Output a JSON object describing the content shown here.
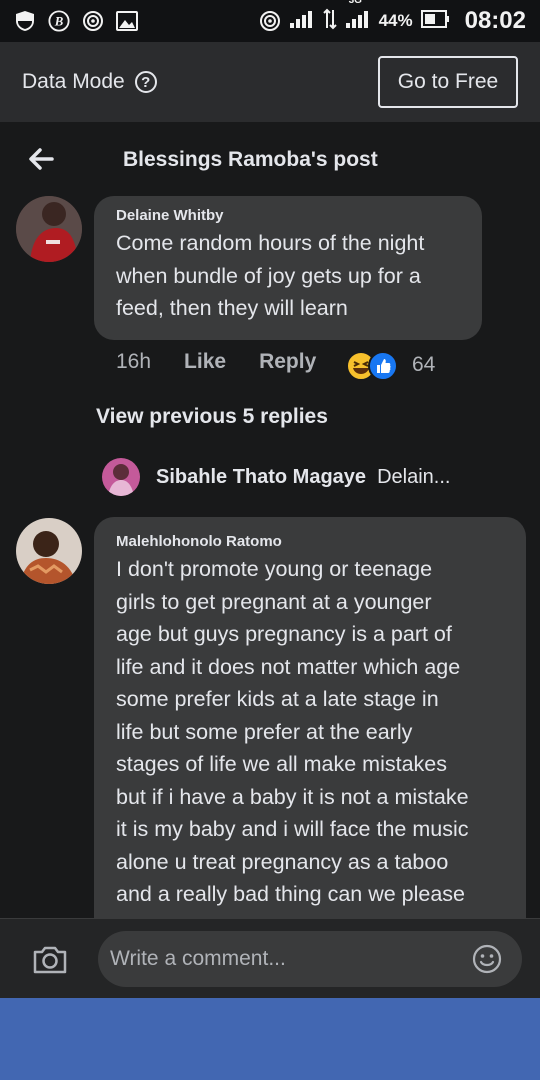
{
  "status_bar": {
    "battery": "44%",
    "time": "08:02",
    "network": "3G"
  },
  "data_mode": {
    "label": "Data Mode",
    "help_icon": "?",
    "go_free_label": "Go to Free"
  },
  "header": {
    "title": "Blessings Ramoba's post"
  },
  "comments": [
    {
      "author": "Delaine Whitby",
      "lines": [
        "Come random hours of the night",
        "when bundle of joy gets up for a",
        "feed, then they will learn"
      ],
      "time": "16h",
      "like_label": "Like",
      "reply_label": "Reply",
      "reaction_count": "64"
    },
    {
      "author": "Malehlohonolo Ratomo",
      "lines": [
        "I don't promote young or teenage",
        "girls  to get pregnant at a younger",
        "age but guys pregnancy is a part of",
        "life and it does not matter which age",
        "some prefer kids at a late stage in",
        "life but some prefer at the early",
        "stages of life we all make mistakes",
        "but if i have a baby it is not a mistake",
        "it is my baby and i will face the music",
        "alone u treat pregnancy as a taboo",
        "and a really bad thing can we please"
      ]
    }
  ],
  "view_previous": "View previous 5 replies",
  "reply_preview": {
    "author": "Sibahle Thato Magaye",
    "snippet": "Delain..."
  },
  "composer": {
    "placeholder": "Write a comment..."
  },
  "colors": {
    "background": "#18191a",
    "bubble": "#3a3b3c",
    "nav": "#4267b2"
  }
}
